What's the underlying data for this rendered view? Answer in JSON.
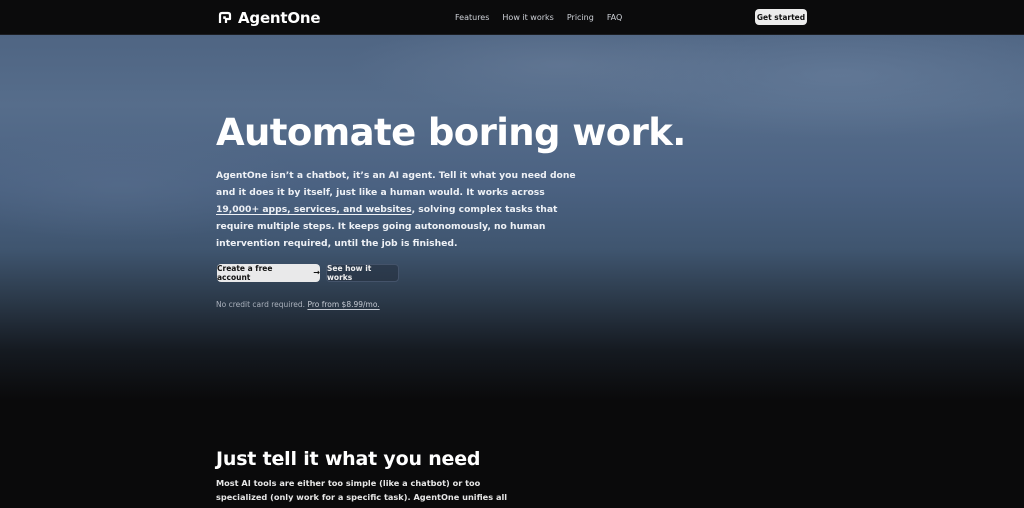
{
  "header": {
    "brand": "AgentOne",
    "nav": [
      "Features",
      "How it works",
      "Pricing",
      "FAQ"
    ],
    "cta": "Get started"
  },
  "hero": {
    "title": "Automate boring work.",
    "desc_part1": "AgentOne isn’t a chatbot, it’s an AI agent. Tell it what you need done and it does it by itself, just like a human would. It works across ",
    "desc_link": "19,000+ apps, services, and websites",
    "desc_part2": ", solving complex tasks that require multiple steps. It keeps going autonomously, no human intervention required, until the job is finished.",
    "primary_button": "Create a free account",
    "secondary_button": "See how it works",
    "fine_print": "No credit card required.",
    "pro_link": "Pro from $8.99/mo."
  },
  "section": {
    "title": "Just tell it what you need",
    "desc": "Most AI tools are either too simple (like a chatbot) or too specialized (only work for a specific task). AgentOne unifies all yours tools and does the work for you, first to last, it's done, with"
  },
  "colors": {
    "background": "#0a0a0b",
    "hero_blue": "#4f6583",
    "button_light": "#e9e9ea"
  }
}
